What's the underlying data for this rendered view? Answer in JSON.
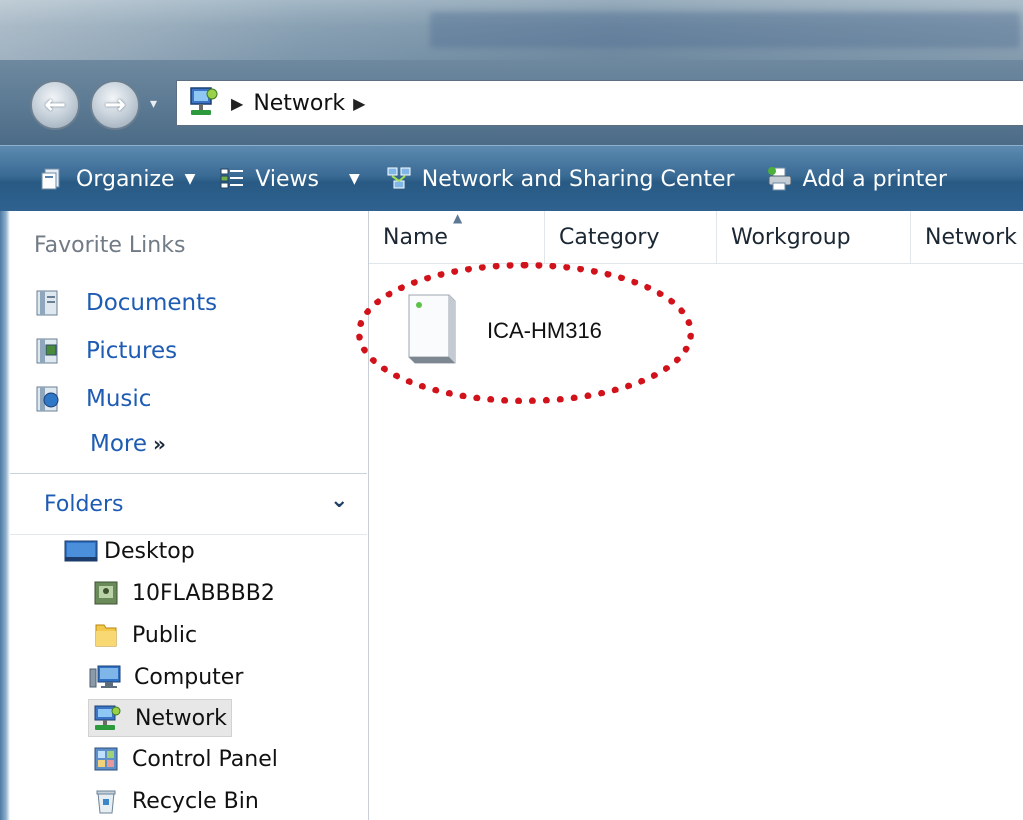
{
  "address": {
    "location": "Network"
  },
  "toolbar": {
    "organize": "Organize",
    "views": "Views",
    "network_sharing": "Network and Sharing Center",
    "add_printer": "Add a printer"
  },
  "favorite_links": {
    "header": "Favorite Links",
    "items": [
      {
        "label": "Documents",
        "icon": "documents-icon"
      },
      {
        "label": "Pictures",
        "icon": "pictures-icon"
      },
      {
        "label": "Music",
        "icon": "music-icon"
      }
    ],
    "more": "More"
  },
  "folders": {
    "header": "Folders",
    "items": [
      {
        "label": "Desktop",
        "icon": "desktop-icon"
      },
      {
        "label": "10FLABBBB2",
        "icon": "user-folder-icon"
      },
      {
        "label": "Public",
        "icon": "folder-icon"
      },
      {
        "label": "Computer",
        "icon": "computer-icon"
      },
      {
        "label": "Network",
        "icon": "network-icon",
        "selected": true
      },
      {
        "label": "Control Panel",
        "icon": "control-panel-icon"
      },
      {
        "label": "Recycle Bin",
        "icon": "recycle-bin-icon"
      }
    ]
  },
  "columns": [
    "Name",
    "Category",
    "Workgroup",
    "Network"
  ],
  "devices": [
    {
      "label": "ICA-HM316",
      "icon": "network-device-icon"
    }
  ],
  "colors": {
    "link": "#1e5cb3",
    "command_bar": "#285a84",
    "highlight": "#d2121a"
  }
}
